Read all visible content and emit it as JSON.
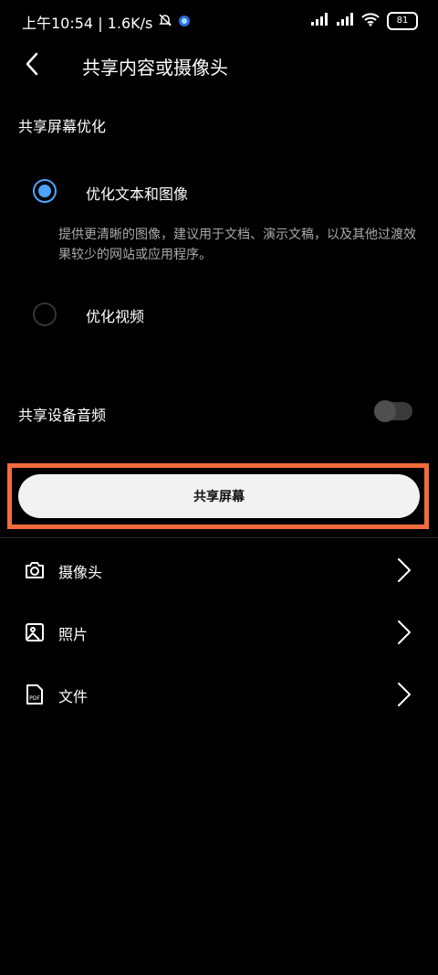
{
  "status_bar": {
    "time_speed": "上午10:54 | 1.6K/s",
    "battery": "81"
  },
  "header": {
    "title": "共享内容或摄像头"
  },
  "optimization": {
    "section_label": "共享屏幕优化",
    "options": [
      {
        "label": "优化文本和图像",
        "selected": true,
        "description": "提供更清晰的图像，建议用于文档、演示文稿，以及其他过渡效果较少的网站或应用程序。"
      },
      {
        "label": "优化视频",
        "selected": false
      }
    ]
  },
  "audio": {
    "label": "共享设备音频",
    "enabled": false
  },
  "share_button": {
    "label": "共享屏幕"
  },
  "list": [
    {
      "label": "摄像头",
      "icon": "camera-icon"
    },
    {
      "label": "照片",
      "icon": "photo-icon"
    },
    {
      "label": "文件",
      "icon": "pdf-file-icon",
      "icon_text": "PDF"
    }
  ],
  "colors": {
    "accent": "#4da3ff",
    "highlight": "#f26b3a",
    "background": "#000000"
  }
}
